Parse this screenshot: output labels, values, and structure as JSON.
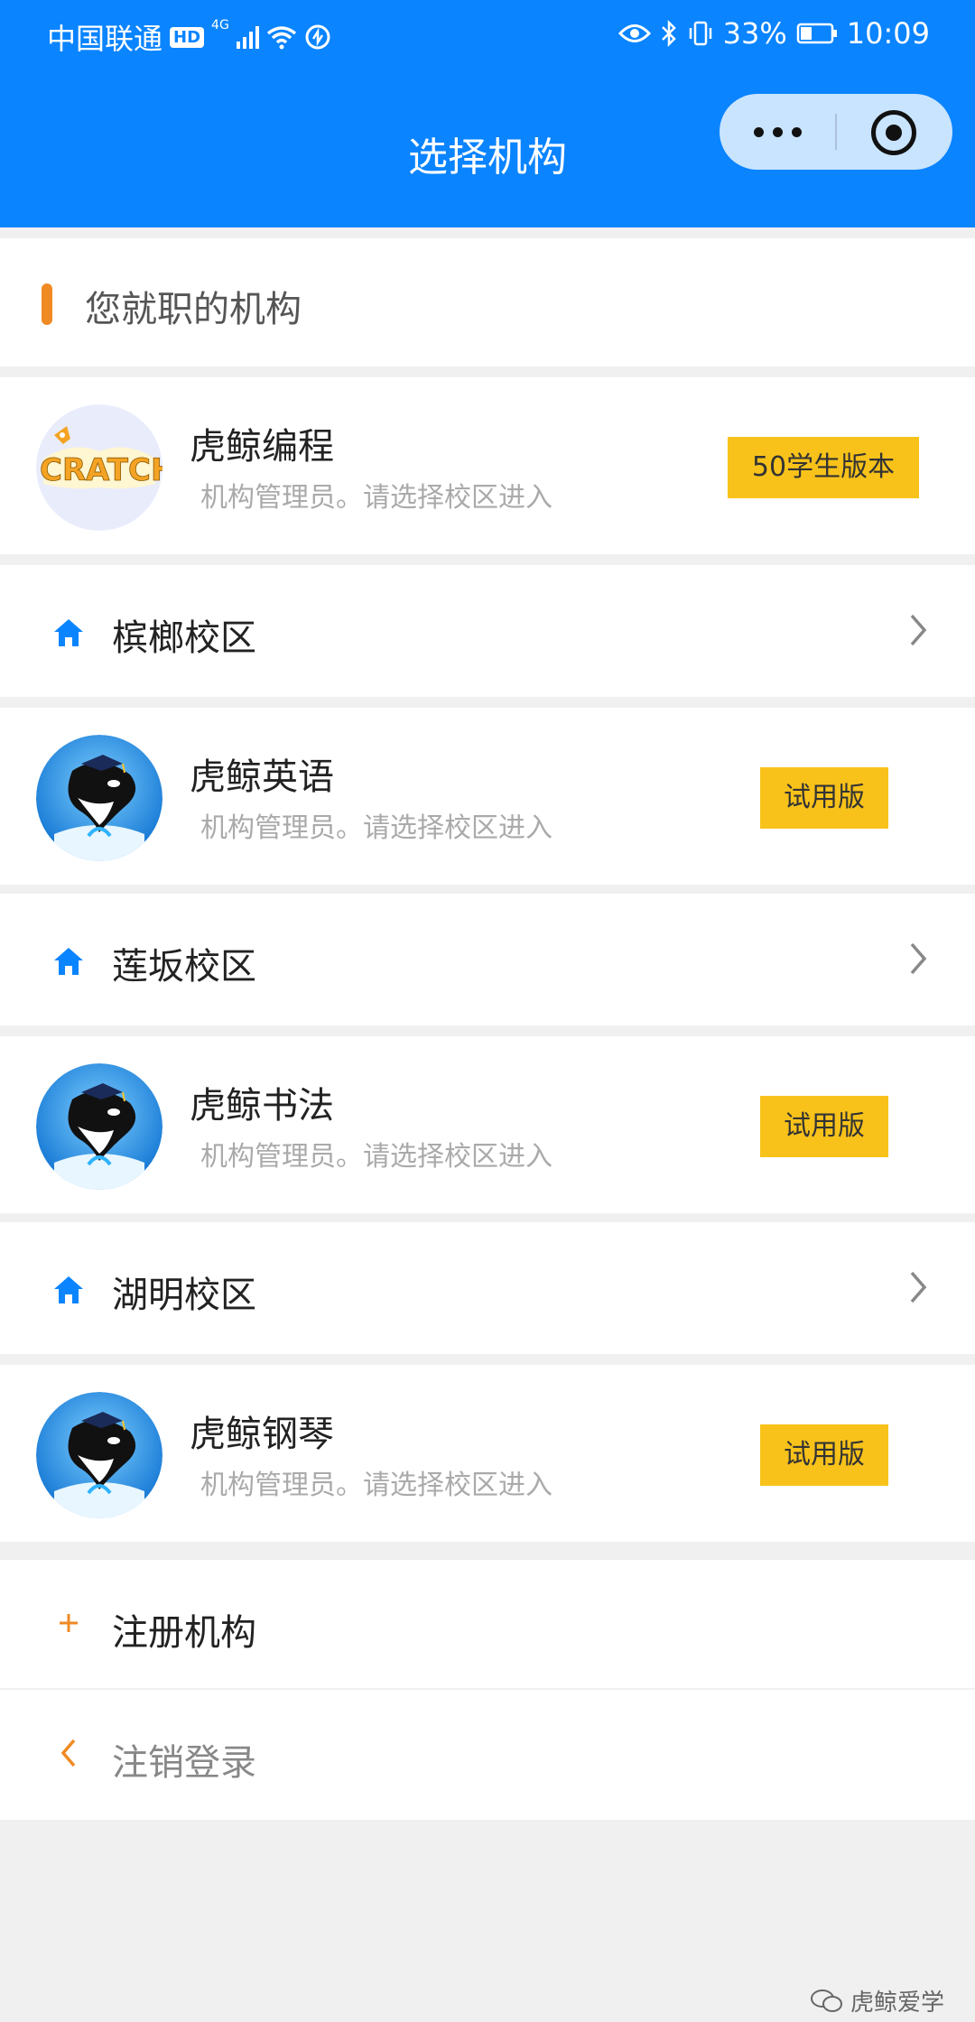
{
  "status_bar": {
    "carrier": "中国联通",
    "hd": "HD",
    "network": "4G",
    "battery": "33%",
    "time": "10:09"
  },
  "nav": {
    "title": "选择机构"
  },
  "section": {
    "title": "您就职的机构"
  },
  "orgs": [
    {
      "name": "虎鲸编程",
      "desc": "机构管理员。请选择校区进入",
      "badge": "50学生版本",
      "avatar": "scratch-logo",
      "campus": "槟榔校区"
    },
    {
      "name": "虎鲸英语",
      "desc": "机构管理员。请选择校区进入",
      "badge": "试用版",
      "avatar": "orca-logo",
      "campus": "莲坂校区"
    },
    {
      "name": "虎鲸书法",
      "desc": "机构管理员。请选择校区进入",
      "badge": "试用版",
      "avatar": "orca-logo",
      "campus": "湖明校区"
    },
    {
      "name": "虎鲸钢琴",
      "desc": "机构管理员。请选择校区进入",
      "badge": "试用版",
      "avatar": "orca-logo"
    }
  ],
  "actions": {
    "register": "注册机构",
    "logout": "注销登录"
  },
  "logo_text": {
    "scratch": "CRATCH"
  },
  "watermark": "虎鲸爱学",
  "colors": {
    "primary": "#0a84ff",
    "accent": "#f08a24",
    "badge": "#f8c21a"
  }
}
